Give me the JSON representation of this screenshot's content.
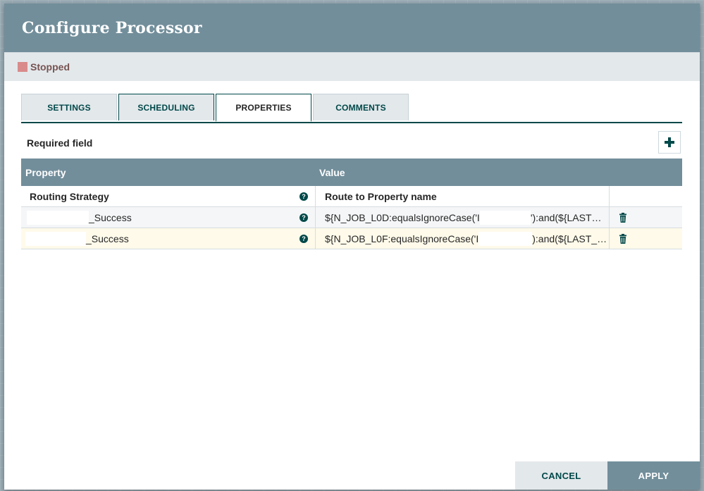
{
  "dialog": {
    "title": "Configure Processor",
    "status": {
      "label": "Stopped",
      "color": "#d98b8b"
    }
  },
  "tabs": [
    {
      "label": "SETTINGS",
      "active": false
    },
    {
      "label": "SCHEDULING",
      "active": false
    },
    {
      "label": "PROPERTIES",
      "active": true
    },
    {
      "label": "COMMENTS",
      "active": false
    }
  ],
  "properties": {
    "required_label": "Required field",
    "add_icon": "plus-icon",
    "columns": {
      "property": "Property",
      "value": "Value"
    },
    "rows": [
      {
        "property": "Routing Strategy",
        "value": "Route to Property name",
        "required": true,
        "deletable": false
      },
      {
        "property_suffix": "_Success",
        "value_prefix": "${N_JOB_L0D:equalsIgnoreCase('I",
        "value_suffix": "'):and(${LAST…",
        "deletable": true
      },
      {
        "property_suffix": "_Success",
        "value_prefix": "${N_JOB_L0F:equalsIgnoreCase('I",
        "value_suffix": "):and(${LAST_…",
        "deletable": true
      }
    ]
  },
  "footer": {
    "cancel_label": "CANCEL",
    "apply_label": "APPLY"
  },
  "colors": {
    "header": "#728e9b",
    "accent": "#004849",
    "highlight_row": "#fffaea"
  }
}
